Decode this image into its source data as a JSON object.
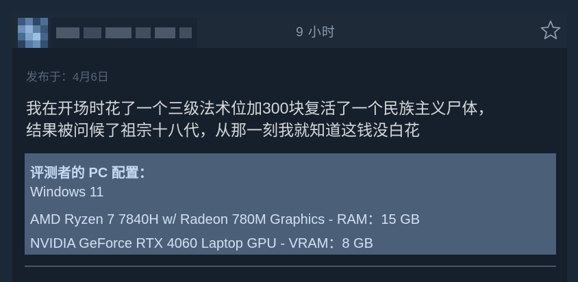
{
  "review": {
    "hours": "9 小时",
    "posted": "发布于：4月6日",
    "text_line1": "我在开场时花了一个三级法术位加300块复活了一个民族主义尸体，",
    "text_line2": "结果被问候了祖宗十八代，从那一刻我就知道这钱没白花"
  },
  "specs": {
    "title": "评测者的 PC 配置：",
    "os": "Windows 11",
    "cpu": "AMD Ryzen 7 7840H w/ Radeon 780M Graphics - RAM：15 GB",
    "gpu": "NVIDIA GeForce RTX 4060 Laptop GPU - VRAM：8 GB"
  },
  "icons": {
    "favorite": "star-outline-icon",
    "avatar": "pixelated-avatar"
  },
  "colors": {
    "background": "#1b2838",
    "specs_box": "#4c5f79",
    "accent_text": "#c5dbf2"
  }
}
